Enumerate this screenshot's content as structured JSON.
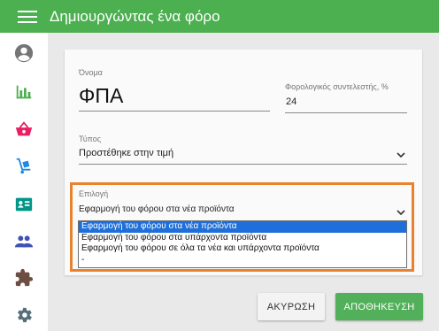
{
  "appbar": {
    "title": "Δημιουργώντας ένα φόρο"
  },
  "sidebar": {
    "items": [
      {
        "icon": "account-circle-icon"
      },
      {
        "icon": "bar-chart-icon"
      },
      {
        "icon": "shopping-basket-icon"
      },
      {
        "icon": "dolly-cart-icon"
      },
      {
        "icon": "id-card-icon"
      },
      {
        "icon": "people-icon"
      },
      {
        "icon": "puzzle-icon"
      },
      {
        "icon": "gear-icon"
      }
    ]
  },
  "form": {
    "name_label": "Όνομα",
    "name_value": "ΦΠΑ",
    "rate_label": "Φορολογικός συντελεστής, %",
    "rate_value": "24",
    "type_label": "Τύπος",
    "type_value": "Προστέθηκε στην τιμή",
    "option_label": "Επιλογή",
    "option_value": "Εφαρμογή του φόρου στα νέα προϊόντα",
    "options": [
      "Εφαρμογή του φόρου στα νέα προϊόντα",
      "Εφαρμογή του φόρου στα υπάρχοντα προϊόντα",
      "Εφαρμογή του φόρου σε όλα τα νέα και υπάρχοντα προϊόντα",
      "-"
    ]
  },
  "actions": {
    "cancel_label": "ΑΚΥΡΩΣΗ",
    "save_label": "ΑΠΟΘΗΚΕΥΣΗ"
  },
  "colors": {
    "appbar": "#4caf50",
    "highlight": "#e9822f",
    "selected_option": "#1e6fd9",
    "save_button": "#53b05a"
  }
}
